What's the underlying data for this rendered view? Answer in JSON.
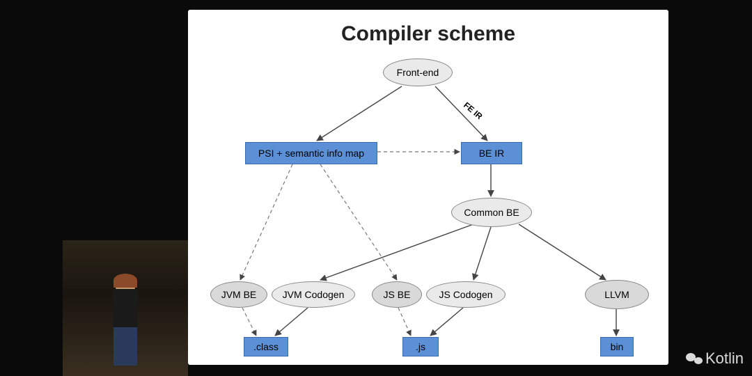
{
  "chart_data": {
    "type": "diagram",
    "title": "Compiler scheme",
    "nodes": [
      {
        "id": "frontend",
        "label": "Front-end",
        "shape": "ellipse",
        "shade": "light"
      },
      {
        "id": "psi",
        "label": "PSI + semantic info map",
        "shape": "rect",
        "shade": "blue"
      },
      {
        "id": "beir",
        "label": "BE IR",
        "shape": "rect",
        "shade": "blue"
      },
      {
        "id": "commonbe",
        "label": "Common BE",
        "shape": "ellipse",
        "shade": "light"
      },
      {
        "id": "jvmbe",
        "label": "JVM BE",
        "shape": "ellipse",
        "shade": "dark"
      },
      {
        "id": "jvmcodogen",
        "label": "JVM Codogen",
        "shape": "ellipse",
        "shade": "light"
      },
      {
        "id": "jsbe",
        "label": "JS BE",
        "shape": "ellipse",
        "shade": "dark"
      },
      {
        "id": "jscodogen",
        "label": "JS Codogen",
        "shape": "ellipse",
        "shade": "light"
      },
      {
        "id": "llvm",
        "label": "LLVM",
        "shape": "ellipse",
        "shade": "dark"
      },
      {
        "id": "class",
        "label": ".class",
        "shape": "rect",
        "shade": "blue"
      },
      {
        "id": "js",
        "label": ".js",
        "shape": "rect",
        "shade": "blue"
      },
      {
        "id": "bin",
        "label": "bin",
        "shape": "rect",
        "shade": "blue"
      }
    ],
    "edges": [
      {
        "from": "frontend",
        "to": "psi",
        "style": "solid"
      },
      {
        "from": "frontend",
        "to": "beir",
        "style": "solid",
        "label": "FE IR"
      },
      {
        "from": "psi",
        "to": "beir",
        "style": "dashed"
      },
      {
        "from": "beir",
        "to": "commonbe",
        "style": "solid"
      },
      {
        "from": "psi",
        "to": "jvmbe",
        "style": "dashed"
      },
      {
        "from": "psi",
        "to": "jsbe",
        "style": "dashed"
      },
      {
        "from": "commonbe",
        "to": "jvmcodogen",
        "style": "solid"
      },
      {
        "from": "commonbe",
        "to": "jscodogen",
        "style": "solid"
      },
      {
        "from": "commonbe",
        "to": "llvm",
        "style": "solid"
      },
      {
        "from": "jvmbe",
        "to": "class",
        "style": "dashed"
      },
      {
        "from": "jvmcodogen",
        "to": "class",
        "style": "solid"
      },
      {
        "from": "jsbe",
        "to": "js",
        "style": "dashed"
      },
      {
        "from": "jscodogen",
        "to": "js",
        "style": "solid"
      },
      {
        "from": "llvm",
        "to": "bin",
        "style": "solid"
      }
    ]
  },
  "watermark": {
    "label": "Kotlin"
  }
}
